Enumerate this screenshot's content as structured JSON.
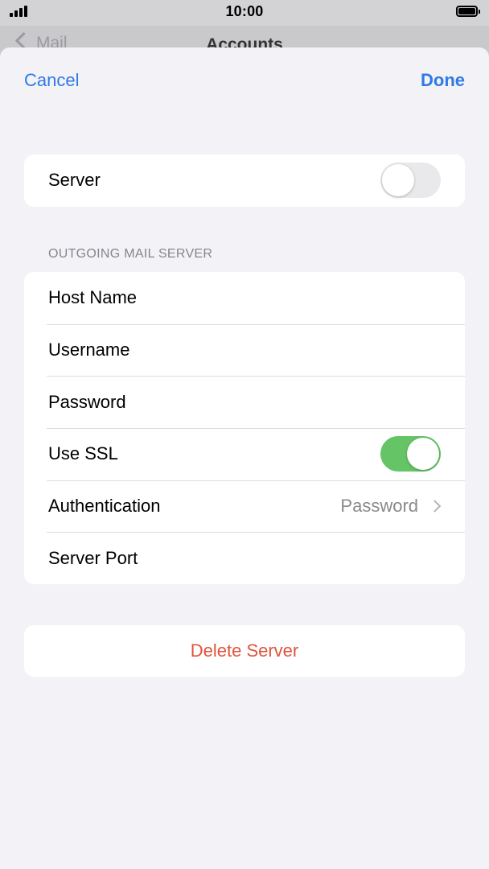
{
  "status_bar": {
    "time": "10:00"
  },
  "background_nav": {
    "back_label": "Mail",
    "title": "Accounts"
  },
  "sheet": {
    "cancel_label": "Cancel",
    "done_label": "Done"
  },
  "server_group": {
    "label": "Server",
    "enabled": false
  },
  "outgoing": {
    "header": "OUTGOING MAIL SERVER",
    "rows": [
      {
        "label": "Host Name"
      },
      {
        "label": "Username"
      },
      {
        "label": "Password"
      },
      {
        "label": "Use SSL",
        "enabled": true
      },
      {
        "label": "Authentication",
        "value": "Password"
      },
      {
        "label": "Server Port"
      }
    ]
  },
  "delete_label": "Delete Server",
  "colors": {
    "accent": "#2f7ae5",
    "toggle_on": "#65c466",
    "destructive": "#e0533d"
  }
}
